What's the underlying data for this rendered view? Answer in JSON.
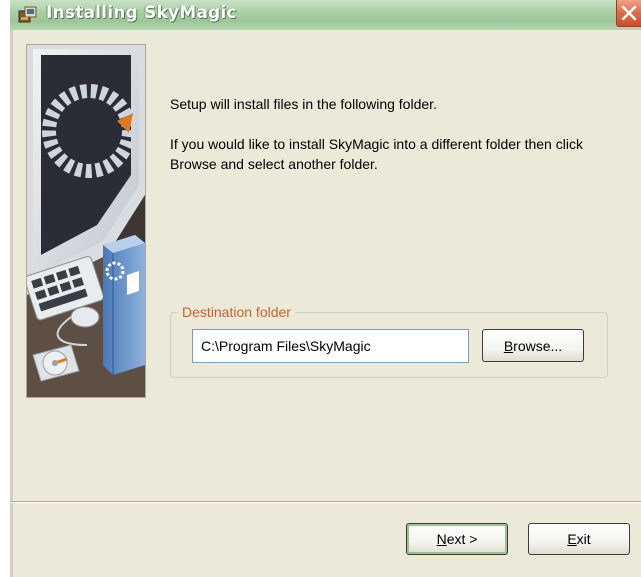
{
  "window": {
    "title": "Installing SkyMagic",
    "close_label": "Close"
  },
  "content": {
    "intro": "Setup will install files in the following folder.",
    "instructions": "If you would like to install SkyMagic into a different folder then click Browse and select another folder."
  },
  "destination": {
    "group_label": "Destination folder",
    "path": "C:\\Program Files\\SkyMagic",
    "browse_label_prefix": "B",
    "browse_label_rest": "rowse..."
  },
  "footer": {
    "next_label_prefix": "N",
    "next_label_rest": "ext >",
    "exit_label_prefix": "E",
    "exit_label_rest": "xit"
  },
  "colors": {
    "dialog_bg": "#ECE9D8",
    "group_label": "#c4662a",
    "title_bar": "#a9cfa5"
  },
  "icons": {
    "title": "installer-icon",
    "close": "close-icon",
    "banner": "installer-illustration"
  }
}
